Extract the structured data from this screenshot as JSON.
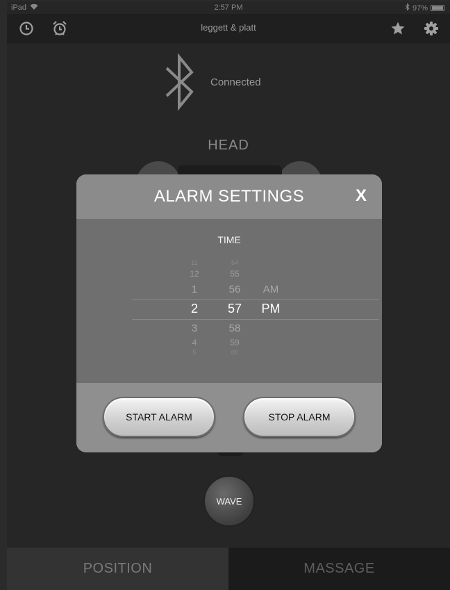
{
  "status_bar": {
    "device": "iPad",
    "time": "2:57 PM",
    "battery": "97%",
    "battery_level": 0.97
  },
  "nav": {
    "title": "leggett & platt",
    "icons": [
      "clock-icon",
      "alarm-clock-icon",
      "star-icon",
      "gear-icon"
    ]
  },
  "bluetooth": {
    "icon": "bluetooth-icon",
    "status": "Connected"
  },
  "section_label": "HEAD",
  "alarm_modal": {
    "title": "ALARM SETTINGS",
    "close_label": "X",
    "time_label": "TIME",
    "picker": {
      "hours": [
        "11",
        "12",
        "1",
        "2",
        "3",
        "4",
        "5"
      ],
      "minutes": [
        "54",
        "55",
        "56",
        "57",
        "58",
        "59",
        "00"
      ],
      "periods": [
        "AM",
        "PM"
      ],
      "selected": {
        "hour": "2",
        "minute": "57",
        "period": "PM"
      }
    },
    "start_button": "START ALARM",
    "stop_button": "STOP ALARM"
  },
  "wave_button": "WAVE",
  "tabs": [
    {
      "label": "POSITION",
      "active": true
    },
    {
      "label": "MASSAGE",
      "active": false
    }
  ]
}
